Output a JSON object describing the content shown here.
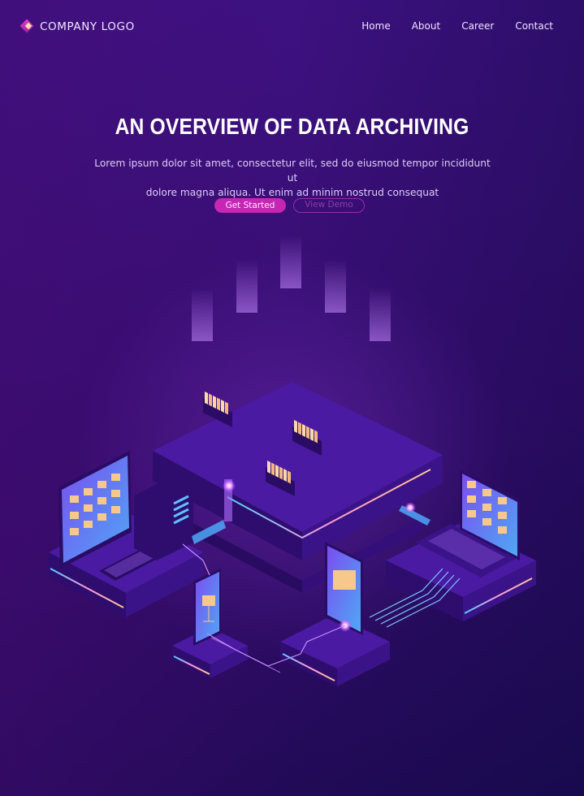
{
  "header": {
    "logo_text": "COMPANY LOGO",
    "nav": [
      {
        "label": "Home"
      },
      {
        "label": "About"
      },
      {
        "label": "Career"
      },
      {
        "label": "Contact"
      }
    ]
  },
  "hero": {
    "title": "AN OVERVIEW OF DATA ARCHIVING",
    "subtitle_line1": "Lorem ipsum dolor sit amet, consectetur elit, sed do eiusmod tempor incididunt ut",
    "subtitle_line2": "dolore magna aliqua. Ut enim ad minim nostrud consequat",
    "primary_button": "Get Started",
    "secondary_button": "View Demo"
  },
  "illustration": {
    "subject": "isometric data archiving: server racks with file drawers, desktop computer, laptop and smartphones connected by glowing data lines",
    "icons": [
      "server-rack-icon",
      "file-drawer-icon",
      "desktop-computer-icon",
      "laptop-icon",
      "smartphone-icon",
      "folder-icon"
    ]
  },
  "colors": {
    "background_top": "#3f1284",
    "background_bottom": "#1d0a52",
    "accent": "#c527b2",
    "outline_button": "#9a2ba6",
    "folder": "#f6c98a",
    "glow_cyan": "#4fd0ff"
  }
}
